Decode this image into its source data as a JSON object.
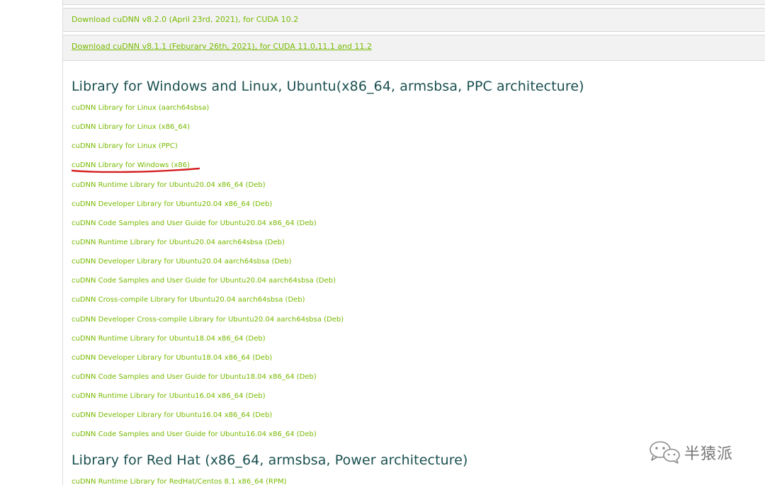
{
  "downloads": [
    {
      "label": "Download cuDNN v8.2.0 (April 23rd, 2021), for CUDA 10.2"
    },
    {
      "label": "Download cuDNN v8.1.1 (Feburary 26th, 2021), for CUDA 11.0,11.1 and 11.2"
    }
  ],
  "section_windows_linux": {
    "title": "Library for Windows and Linux, Ubuntu(x86_64, armsbsa, PPC architecture)",
    "links": [
      "cuDNN Library for Linux (aarch64sbsa)",
      "cuDNN Library for Linux (x86_64)",
      "cuDNN Library for Linux (PPC)",
      "cuDNN Library for Windows (x86)",
      "cuDNN Runtime Library for Ubuntu20.04 x86_64 (Deb)",
      "cuDNN Developer Library for Ubuntu20.04 x86_64 (Deb)",
      "cuDNN Code Samples and User Guide for Ubuntu20.04 x86_64 (Deb)",
      "cuDNN Runtime Library for Ubuntu20.04 aarch64sbsa (Deb)",
      "cuDNN Developer Library for Ubuntu20.04 aarch64sbsa (Deb)",
      "cuDNN Code Samples and User Guide for Ubuntu20.04 aarch64sbsa (Deb)",
      "cuDNN Cross-compile Library for Ubuntu20.04 aarch64sbsa (Deb)",
      "cuDNN Developer Cross-compile Library for Ubuntu20.04 aarch64sbsa (Deb)",
      "cuDNN Runtime Library for Ubuntu18.04 x86_64 (Deb)",
      "cuDNN Developer Library for Ubuntu18.04 x86_64 (Deb)",
      "cuDNN Code Samples and User Guide for Ubuntu18.04 x86_64 (Deb)",
      "cuDNN Runtime Library for Ubuntu16.04 x86_64 (Deb)",
      "cuDNN Developer Library for Ubuntu16.04 x86_64 (Deb)",
      "cuDNN Code Samples and User Guide for Ubuntu16.04 x86_64 (Deb)"
    ]
  },
  "section_redhat": {
    "title": "Library for Red Hat (x86_64, armsbsa, Power architecture)",
    "links": [
      "cuDNN Runtime Library for RedHat/Centos 8.1 x86_64 (RPM)"
    ]
  },
  "watermark": {
    "text": "半猿派",
    "icon": "wechat-icon"
  },
  "colors": {
    "link": "#76b900",
    "heading": "#1a4f4f",
    "row_background": "#f2f2f2",
    "highlight_underline": "#d42020"
  }
}
